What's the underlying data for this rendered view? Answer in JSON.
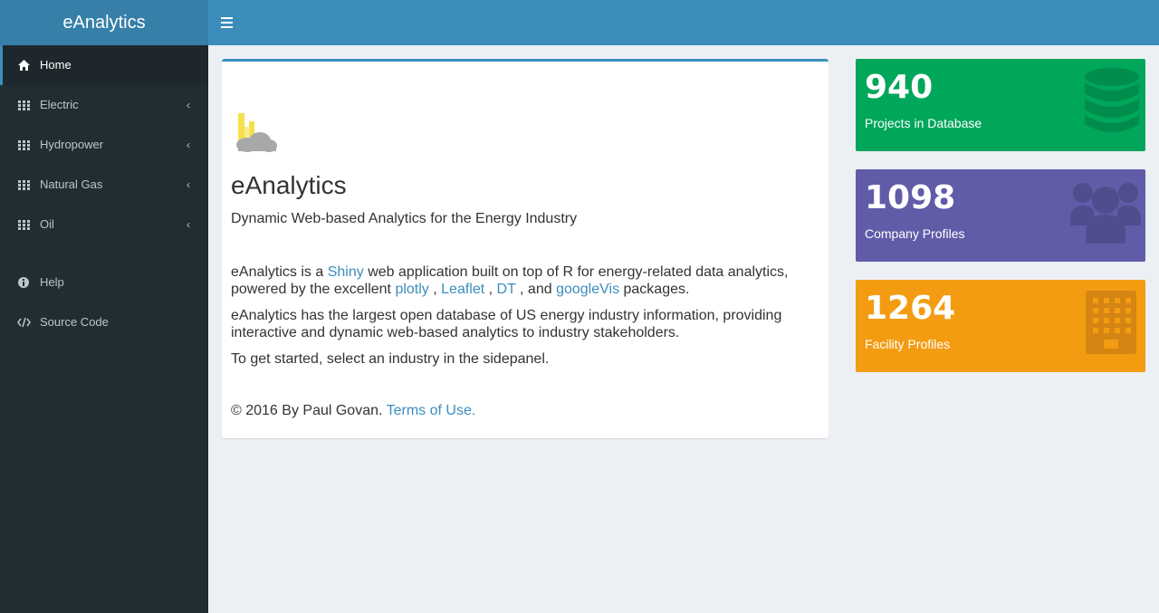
{
  "app": {
    "title": "eAnalytics"
  },
  "sidebar": {
    "items": [
      {
        "label": "Home",
        "icon": "home-icon",
        "active": true,
        "has_submenu": false
      },
      {
        "label": "Electric",
        "icon": "grid-icon",
        "has_submenu": true
      },
      {
        "label": "Hydropower",
        "icon": "grid-icon",
        "has_submenu": true
      },
      {
        "label": "Natural Gas",
        "icon": "grid-icon",
        "has_submenu": true
      },
      {
        "label": "Oil",
        "icon": "grid-icon",
        "has_submenu": true
      }
    ],
    "secondary": [
      {
        "label": "Help",
        "icon": "info-icon"
      },
      {
        "label": "Source Code",
        "icon": "code-icon"
      }
    ],
    "chevron": "‹"
  },
  "main": {
    "title": "eAnalytics",
    "subtitle": "Dynamic Web-based Analytics for the Energy Industry",
    "para1": {
      "t1": "eAnalytics is a ",
      "link_shiny": "Shiny",
      "t2": " web application built on top of R for energy-related data analytics, powered by the excellent ",
      "link_plotly": "plotly",
      "sep1": " , ",
      "link_leaflet": "Leaflet",
      "sep2": " , ",
      "link_dt": "DT",
      "sep3": " , and ",
      "link_googlevis": "googleVis",
      "t3": " packages."
    },
    "para2": "eAnalytics has the largest open database of US energy industry information, providing interactive and dynamic web-based analytics to industry stakeholders.",
    "para3": "To get started, select an industry in the sidepanel.",
    "footer": {
      "copyright": "© 2016 By Paul Govan. ",
      "terms_link": "Terms of Use."
    }
  },
  "value_boxes": [
    {
      "value": "940",
      "label": "Projects in Database",
      "icon": "database-icon",
      "color": "#00a65a"
    },
    {
      "value": "1098",
      "label": "Company Profiles",
      "icon": "users-icon",
      "color": "#605ca8"
    },
    {
      "value": "1264",
      "label": "Facility Profiles",
      "icon": "building-icon",
      "color": "#f39c12"
    }
  ],
  "colors": {
    "header": "#3c8dbc",
    "logo_bg": "#367fa9",
    "sidebar": "#222d32",
    "content_bg": "#ecf0f5"
  }
}
